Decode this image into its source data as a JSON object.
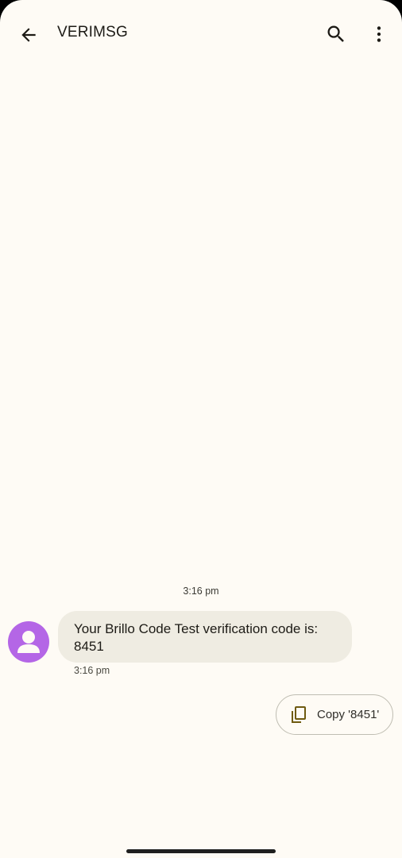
{
  "header": {
    "title": "VERIMSG"
  },
  "icons": {
    "back": "arrow-back-icon",
    "search": "search-icon",
    "more": "more-vert-icon",
    "avatar": "person-icon",
    "copy": "copy-icon"
  },
  "conversation": {
    "date_separator": "3:16 pm",
    "messages": [
      {
        "text": "Your Brillo Code Test verification code is: 8451",
        "time": "3:16 pm"
      }
    ]
  },
  "suggestions": {
    "copy_label": "Copy '8451'"
  },
  "colors": {
    "background": "#fefbf5",
    "bubble": "#efece2",
    "avatar": "#b466e6",
    "copy_icon": "#6e5a10"
  }
}
